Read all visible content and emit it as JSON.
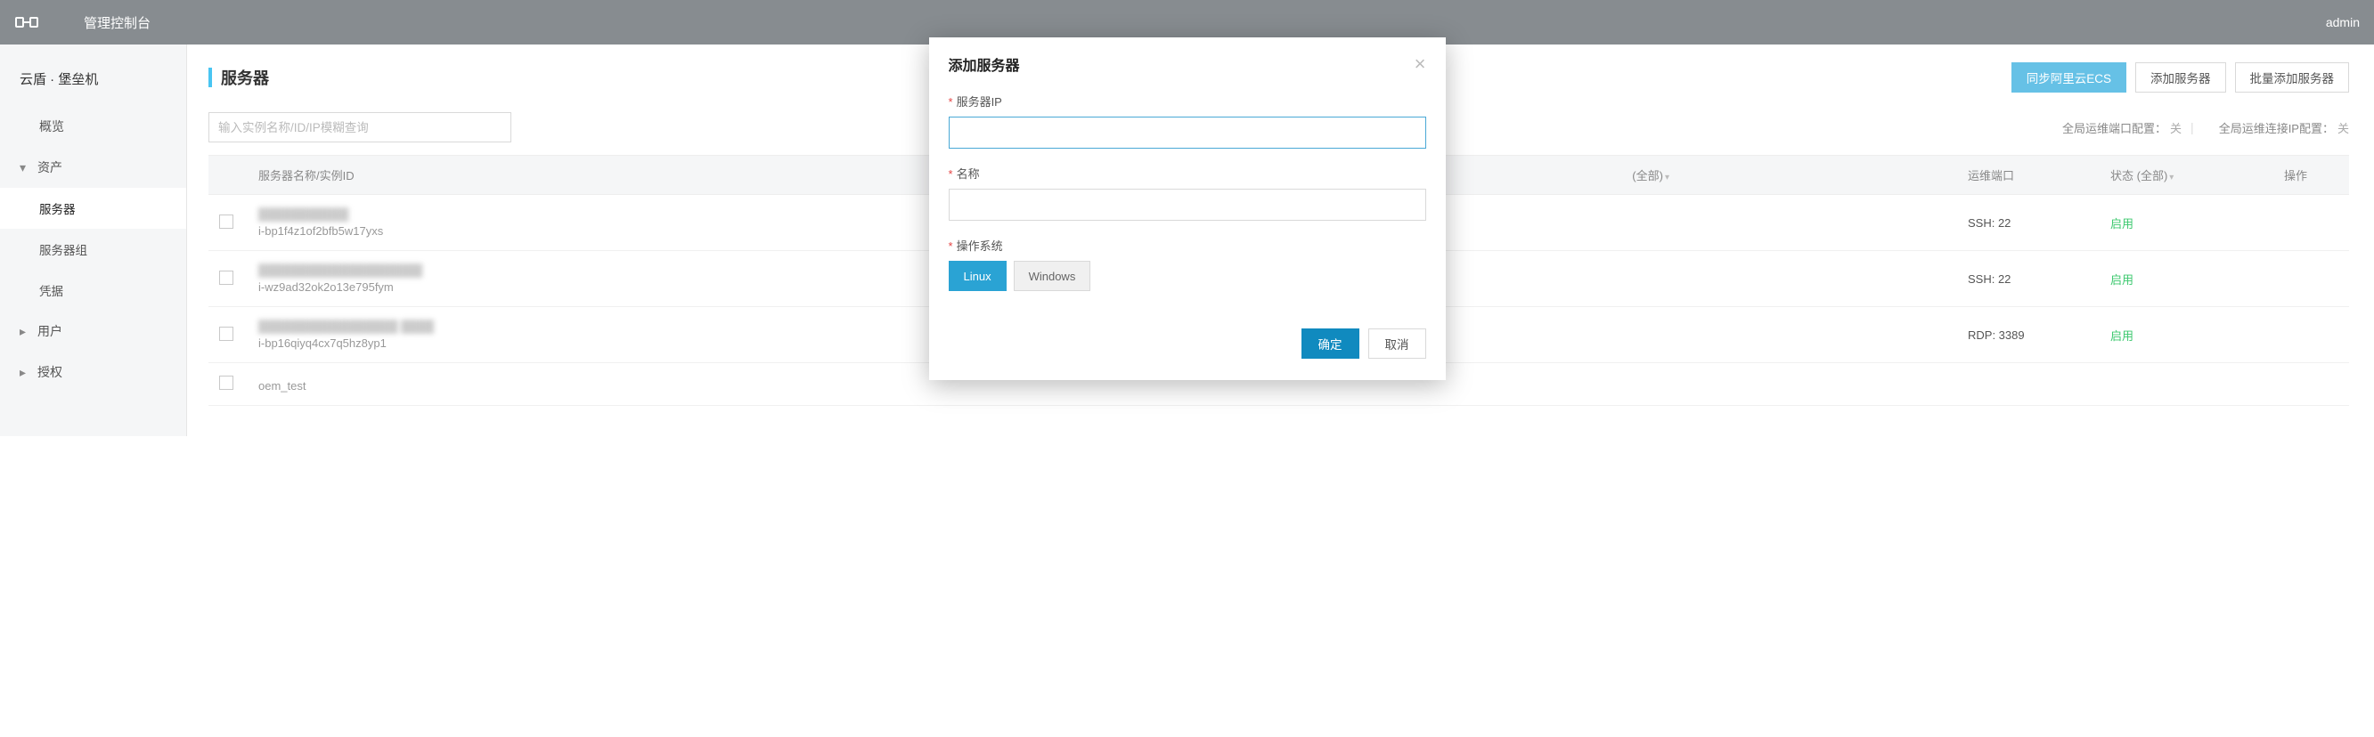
{
  "header": {
    "app_title": "管理控制台",
    "user": "admin"
  },
  "sidebar": {
    "product": "云盾 · 堡垒机",
    "items": [
      {
        "label": "概览",
        "type": "plain"
      },
      {
        "label": "资产",
        "type": "group",
        "expanded": true
      },
      {
        "label": "服务器",
        "type": "child",
        "active": true
      },
      {
        "label": "服务器组",
        "type": "child"
      },
      {
        "label": "凭据",
        "type": "child"
      },
      {
        "label": "用户",
        "type": "group",
        "expanded": false
      },
      {
        "label": "授权",
        "type": "group",
        "expanded": false
      }
    ]
  },
  "page": {
    "title": "服务器",
    "buttons": {
      "sync_ecs": "同步阿里云ECS",
      "add_server": "添加服务器",
      "batch_add": "批量添加服务器"
    },
    "search_placeholder": "输入实例名称/ID/IP模糊查询",
    "config": {
      "port_label": "全局运维端口配置：",
      "port_value": "关",
      "ip_label": "全局运维连接IP配置：",
      "ip_value": "关"
    }
  },
  "table": {
    "headers": {
      "name": "服务器名称/实例ID",
      "region": "(全部)",
      "port": "运维端口",
      "status": "状态 (全部)",
      "ops": "操作"
    },
    "rows": [
      {
        "name_blur": "███████████",
        "instance_id": "i-bp1f4z1of2bfb5w17yxs",
        "port": "SSH: 22",
        "status": "启用"
      },
      {
        "name_blur": "████████████████████",
        "instance_id": "i-wz9ad32ok2o13e795fym",
        "port": "SSH: 22",
        "status": "启用"
      },
      {
        "name_blur": "█████████████████ ████",
        "instance_id": "i-bp16qiyq4cx7q5hz8yp1",
        "port": "RDP: 3389",
        "status": "启用"
      },
      {
        "name_blur": "",
        "instance_id": "oem_test",
        "port": "",
        "status": ""
      }
    ]
  },
  "modal": {
    "title": "添加服务器",
    "fields": {
      "ip_label": "服务器IP",
      "name_label": "名称",
      "os_label": "操作系统",
      "os_options": {
        "linux": "Linux",
        "windows": "Windows"
      }
    },
    "buttons": {
      "ok": "确定",
      "cancel": "取消"
    }
  }
}
